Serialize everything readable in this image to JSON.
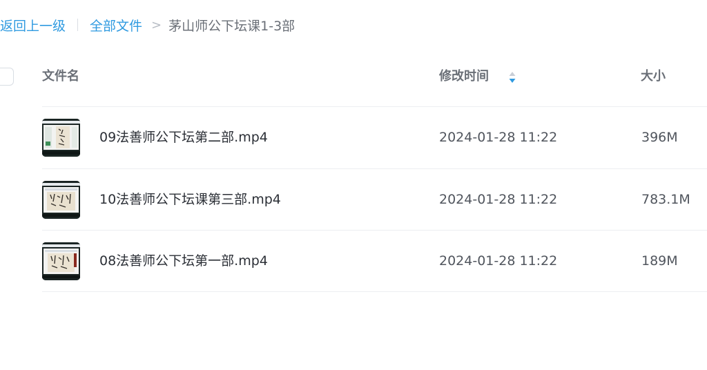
{
  "breadcrumb": {
    "back_label": "返回上一级",
    "all_files_label": "全部文件",
    "arrow": ">",
    "current_folder": "茅山师公下坛课1-3部"
  },
  "table": {
    "columns": {
      "name": "文件名",
      "modified": "修改时间",
      "size": "大小"
    },
    "sort_active_color": "#2f9ae0",
    "rows": [
      {
        "name": "09法善师公下坛第二部.mp4",
        "modified": "2024-01-28 11:22",
        "size": "396M",
        "thumb_icon": "video-thumbnail"
      },
      {
        "name": "10法善师公下坛课第三部.mp4",
        "modified": "2024-01-28 11:22",
        "size": "783.1M",
        "thumb_icon": "video-thumbnail"
      },
      {
        "name": "08法善师公下坛第一部.mp4",
        "modified": "2024-01-28 11:22",
        "size": "189M",
        "thumb_icon": "video-thumbnail"
      }
    ]
  }
}
